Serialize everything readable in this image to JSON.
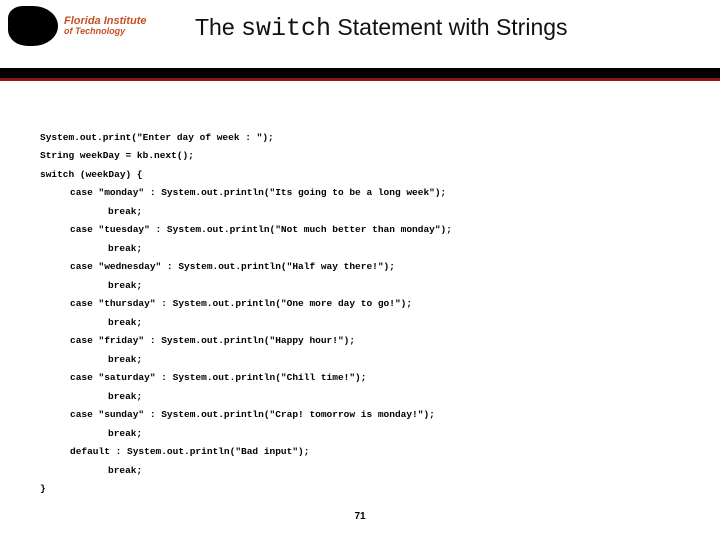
{
  "logo": {
    "line1": "Florida Institute",
    "line2": "of Technology"
  },
  "title": {
    "pre": "The ",
    "mono": "switch",
    "post": " Statement with Strings"
  },
  "code": {
    "l01": "System.out.print(\"Enter day of week : \");",
    "l02": "String weekDay = kb.next();",
    "l03": "switch (weekDay) {",
    "l04": "case \"monday\" : System.out.println(\"Its going to be a long week\");",
    "l05": "break;",
    "l06": "case \"tuesday\" : System.out.println(\"Not much better than monday\");",
    "l07": "break;",
    "l08": "case \"wednesday\" : System.out.println(\"Half way there!\");",
    "l09": "break;",
    "l10": "case \"thursday\" : System.out.println(\"One more day to go!\");",
    "l11": "break;",
    "l12": "case \"friday\" : System.out.println(\"Happy hour!\");",
    "l13": "break;",
    "l14": "case \"saturday\" : System.out.println(\"Chill time!\");",
    "l15": "break;",
    "l16": "case \"sunday\" : System.out.println(\"Crap! tomorrow is monday!\");",
    "l17": "break;",
    "l18": "default : System.out.println(\"Bad input\");",
    "l19": "break;",
    "l20": "}"
  },
  "page_number": "71"
}
